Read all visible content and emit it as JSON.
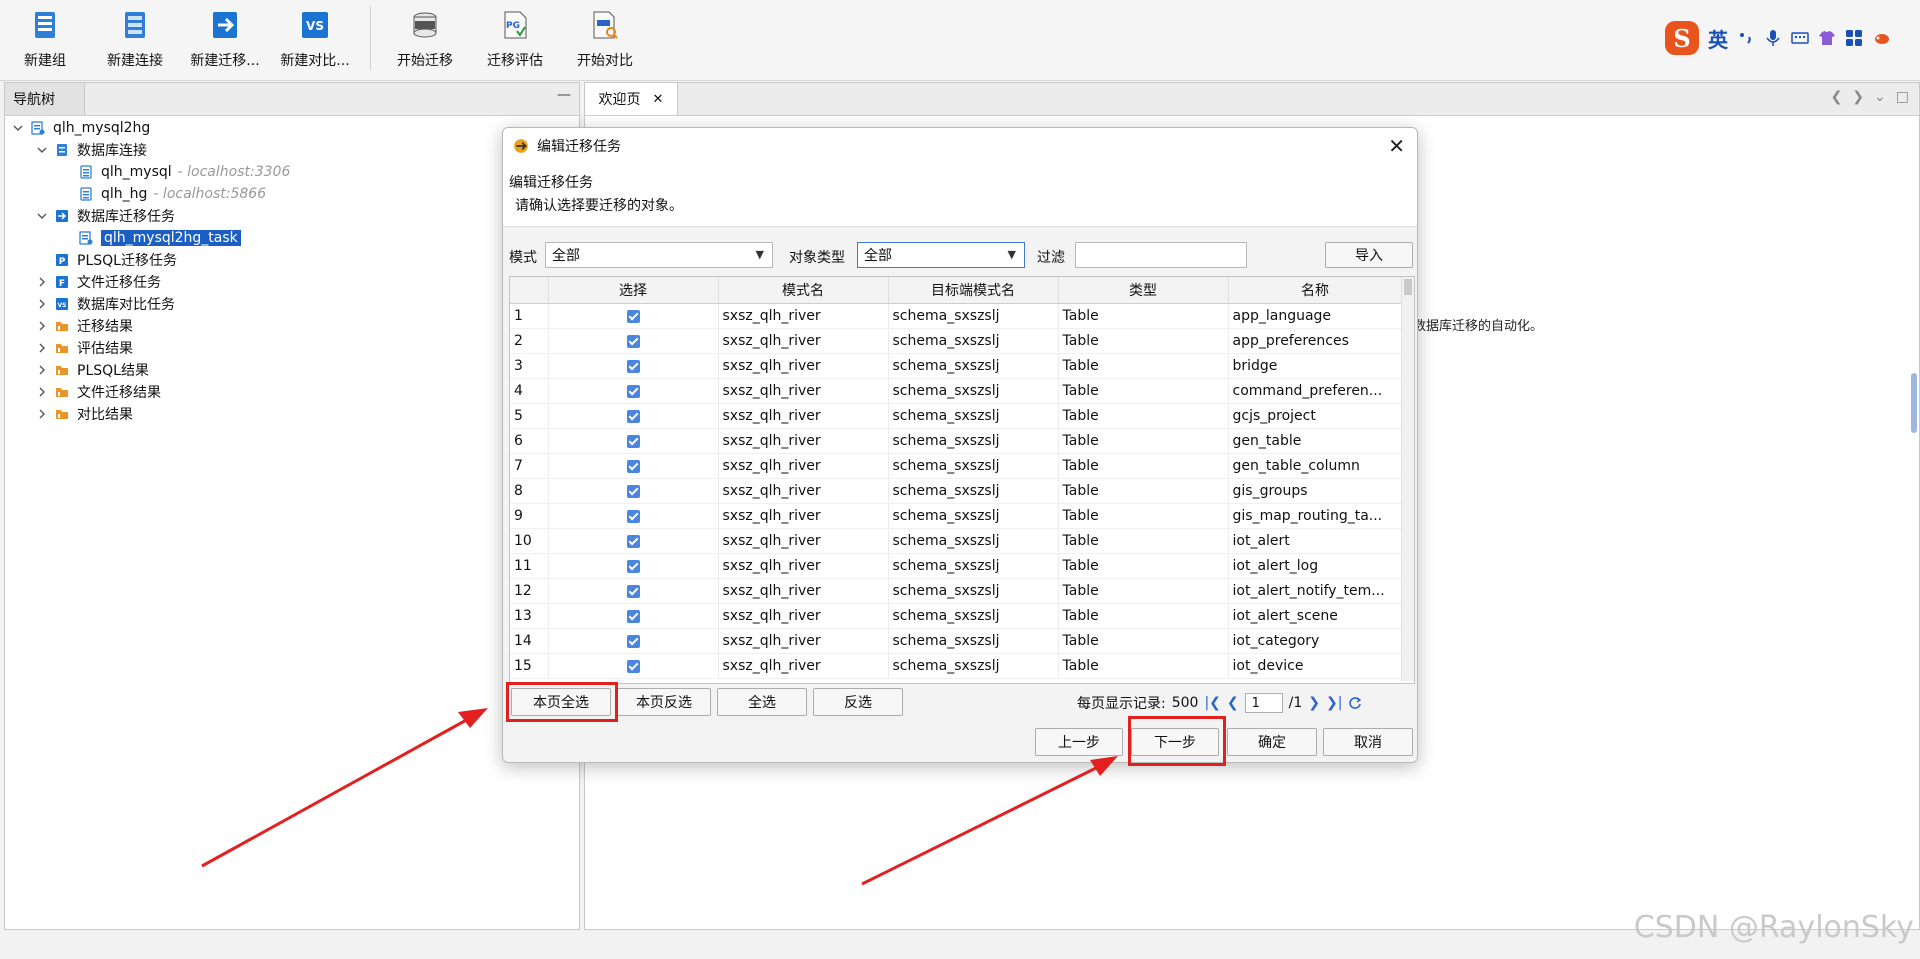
{
  "toolbar": {
    "buttons": [
      {
        "label": "新建组",
        "icon": "new-group-icon"
      },
      {
        "label": "新建连接",
        "icon": "new-connection-icon"
      },
      {
        "label": "新建迁移...",
        "icon": "new-migration-icon"
      },
      {
        "label": "新建对比...",
        "icon": "new-compare-icon"
      },
      {
        "label": "开始迁移",
        "icon": "data-migrate-icon"
      },
      {
        "label": "迁移评估",
        "icon": "pg-assess-icon"
      },
      {
        "label": "开始对比",
        "icon": "code-compare-icon"
      }
    ]
  },
  "ime": {
    "lang": "英"
  },
  "nav": {
    "tab_label": "导航树",
    "minimize": "—",
    "tree": {
      "root": "qlh_mysql2hg",
      "db_conn": "数据库连接",
      "conn1": {
        "name": "qlh_mysql",
        "host": "- localhost:3306"
      },
      "conn2": {
        "name": "qlh_hg",
        "host": "- localhost:5866"
      },
      "migr": "数据库迁移任务",
      "task": "qlh_mysql2hg_task",
      "plsql": "PLSQL迁移任务",
      "file": "文件迁移任务",
      "compare": "数据库对比任务",
      "r1": "迁移结果",
      "r2": "评估结果",
      "r3": "PLSQL结果",
      "r4": "文件迁移结果",
      "r5": "对比结果"
    }
  },
  "editor": {
    "tab_label": "欢迎页",
    "tab_close": "✕",
    "welcome_text": "数据库迁移的自动化。"
  },
  "dialog": {
    "title": "编辑迁移任务",
    "close": "✕",
    "header_title": "编辑迁移任务",
    "header_desc": "请确认选择要迁移的对象。",
    "filter": {
      "mode_label": "模式",
      "mode_value": "全部",
      "type_label": "对象类型",
      "type_value": "全部",
      "filter_label": "过滤",
      "filter_value": "",
      "import_label": "导入"
    },
    "table": {
      "columns": [
        "选择",
        "模式名",
        "目标端模式名",
        "类型",
        "名称"
      ],
      "rows": [
        {
          "no": "1",
          "schema": "sxsz_qlh_river",
          "target": "schema_sxszslj",
          "type": "Table",
          "name": "app_language"
        },
        {
          "no": "2",
          "schema": "sxsz_qlh_river",
          "target": "schema_sxszslj",
          "type": "Table",
          "name": "app_preferences"
        },
        {
          "no": "3",
          "schema": "sxsz_qlh_river",
          "target": "schema_sxszslj",
          "type": "Table",
          "name": "bridge"
        },
        {
          "no": "4",
          "schema": "sxsz_qlh_river",
          "target": "schema_sxszslj",
          "type": "Table",
          "name": "command_preferen..."
        },
        {
          "no": "5",
          "schema": "sxsz_qlh_river",
          "target": "schema_sxszslj",
          "type": "Table",
          "name": "gcjs_project"
        },
        {
          "no": "6",
          "schema": "sxsz_qlh_river",
          "target": "schema_sxszslj",
          "type": "Table",
          "name": "gen_table"
        },
        {
          "no": "7",
          "schema": "sxsz_qlh_river",
          "target": "schema_sxszslj",
          "type": "Table",
          "name": "gen_table_column"
        },
        {
          "no": "8",
          "schema": "sxsz_qlh_river",
          "target": "schema_sxszslj",
          "type": "Table",
          "name": "gis_groups"
        },
        {
          "no": "9",
          "schema": "sxsz_qlh_river",
          "target": "schema_sxszslj",
          "type": "Table",
          "name": "gis_map_routing_ta..."
        },
        {
          "no": "10",
          "schema": "sxsz_qlh_river",
          "target": "schema_sxszslj",
          "type": "Table",
          "name": "iot_alert"
        },
        {
          "no": "11",
          "schema": "sxsz_qlh_river",
          "target": "schema_sxszslj",
          "type": "Table",
          "name": "iot_alert_log"
        },
        {
          "no": "12",
          "schema": "sxsz_qlh_river",
          "target": "schema_sxszslj",
          "type": "Table",
          "name": "iot_alert_notify_tem..."
        },
        {
          "no": "13",
          "schema": "sxsz_qlh_river",
          "target": "schema_sxszslj",
          "type": "Table",
          "name": "iot_alert_scene"
        },
        {
          "no": "14",
          "schema": "sxsz_qlh_river",
          "target": "schema_sxszslj",
          "type": "Table",
          "name": "iot_category"
        },
        {
          "no": "15",
          "schema": "sxsz_qlh_river",
          "target": "schema_sxszslj",
          "type": "Table",
          "name": "iot_device"
        }
      ]
    },
    "select_buttons": {
      "page_all": "本页全选",
      "page_invert": "本页反选",
      "all": "全选",
      "invert": "反选"
    },
    "pager": {
      "label": "每页显示记录:",
      "per_page": "500",
      "page": "1",
      "total": "/1"
    },
    "footer": {
      "prev": "上一步",
      "next": "下一步",
      "ok": "确定",
      "cancel": "取消"
    }
  },
  "annotation_color": "#e32020",
  "watermark": "CSDN @RaylonSky"
}
